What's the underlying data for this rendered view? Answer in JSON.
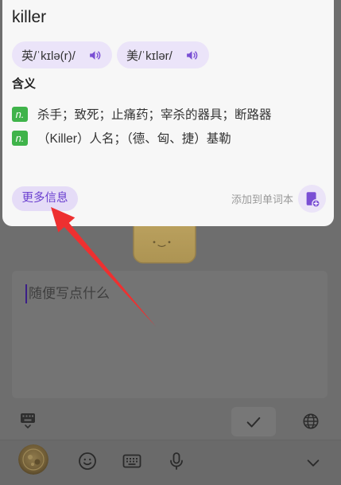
{
  "dictionary_card": {
    "word": "killer",
    "pronunciations": [
      {
        "label": "英/ˈkɪlə(r)/",
        "icon": "speaker-icon"
      },
      {
        "label": "美/ˈkɪlər/",
        "icon": "speaker-icon"
      }
    ],
    "meaning_heading": "含义",
    "definitions": [
      {
        "pos": "n.",
        "text": "杀手；致死；止痛药；宰杀的器具；断路器"
      },
      {
        "pos": "n.",
        "text": "（Killer）人名；（德、匈、捷）基勒"
      }
    ],
    "more_info_label": "更多信息",
    "add_to_wordbook": {
      "label": "添加到单词本",
      "icon": "add-notebook-icon"
    }
  },
  "editor": {
    "placeholder": "随便写点什么"
  },
  "toolbar": {
    "icons": [
      "keyboard-toggle-icon",
      "check-icon",
      "globe-icon"
    ]
  },
  "bottom_bar": {
    "icons": [
      "avatar",
      "emoji-icon",
      "keyboard-icon",
      "microphone-icon",
      "chevron-down-icon"
    ]
  },
  "annotation": {
    "color": "#ee3030"
  },
  "colors": {
    "accent": "#7a4fd4",
    "chip_background": "#ebe4f9",
    "more_info_text": "#6a3fcf",
    "pos_badge": "#3fb34a",
    "card_background": "#f7f7f7",
    "dimmed_background": "#6e6e6e",
    "cursor": "#3b1e87"
  }
}
